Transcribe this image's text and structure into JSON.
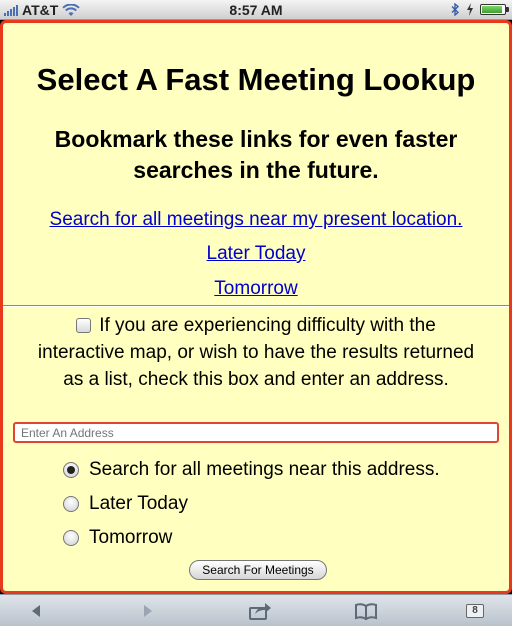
{
  "statusbar": {
    "carrier": "AT&T",
    "time": "8:57 AM"
  },
  "page": {
    "title": "Select A Fast Meeting Lookup",
    "subtitle": "Bookmark these links for even faster searches in the future.",
    "links": [
      "Search for all meetings near my present location.",
      "Later Today",
      "Tomorrow"
    ],
    "checkbox_label": "If you are experiencing difficulty with the interactive map, or wish to have the results returned as a list, check this box and enter an address.",
    "address_placeholder": "Enter An Address",
    "radios": [
      {
        "label": "Search for all meetings near this address.",
        "checked": true
      },
      {
        "label": "Later Today",
        "checked": false
      },
      {
        "label": "Tomorrow",
        "checked": false
      }
    ],
    "submit_label": "Search For Meetings"
  },
  "toolbar": {
    "pages_count": "8"
  },
  "colors": {
    "page_background": "#ffffc0",
    "page_border": "#e83a1a",
    "link": "#0000cc"
  }
}
